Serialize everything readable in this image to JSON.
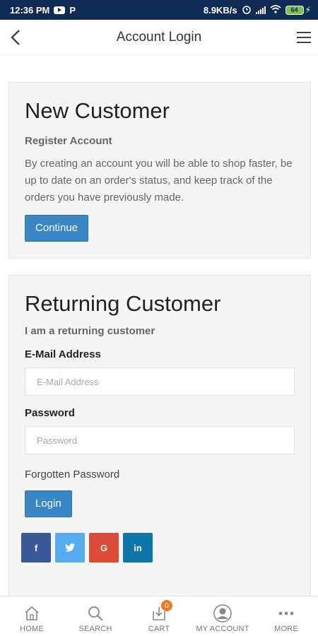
{
  "status_bar": {
    "time": "12:36 PM",
    "p_label": "P",
    "network_speed": "8.9KB/s",
    "battery_level": "64"
  },
  "header": {
    "title": "Account Login",
    "back_icon": "chevron-left-icon",
    "menu_icon": "hamburger-menu-icon"
  },
  "new_customer": {
    "title": "New Customer",
    "subtitle": "Register Account",
    "description": "By creating an account you will be able to shop faster, be up to date on an order's status, and keep track of the orders you have previously made.",
    "continue_label": "Continue"
  },
  "returning_customer": {
    "title": "Returning Customer",
    "subtitle": "I am a returning customer",
    "email_label": "E-Mail Address",
    "email_placeholder": "E-Mail Address",
    "email_value": "",
    "password_label": "Password",
    "password_placeholder": "Password",
    "password_value": "",
    "forgot_label": "Forgotten Password",
    "login_label": "Login"
  },
  "social": [
    {
      "name": "facebook",
      "glyph": "f",
      "color": "#3b5998"
    },
    {
      "name": "twitter",
      "glyph": "t",
      "color": "#55acee"
    },
    {
      "name": "google",
      "glyph": "G",
      "color": "#dd4b39"
    },
    {
      "name": "linkedin",
      "glyph": "in",
      "color": "#0e76a8"
    }
  ],
  "bottom_nav": {
    "home": "HOME",
    "search": "SEARCH",
    "cart": "CART",
    "cart_count": "0",
    "account": "MY ACCOUNT",
    "more": "MORE"
  },
  "colors": {
    "status_bar": "#0f2a54",
    "primary_button": "#3a87c8",
    "badge": "#f47a1f",
    "panel_bg": "#f5f5f5"
  }
}
